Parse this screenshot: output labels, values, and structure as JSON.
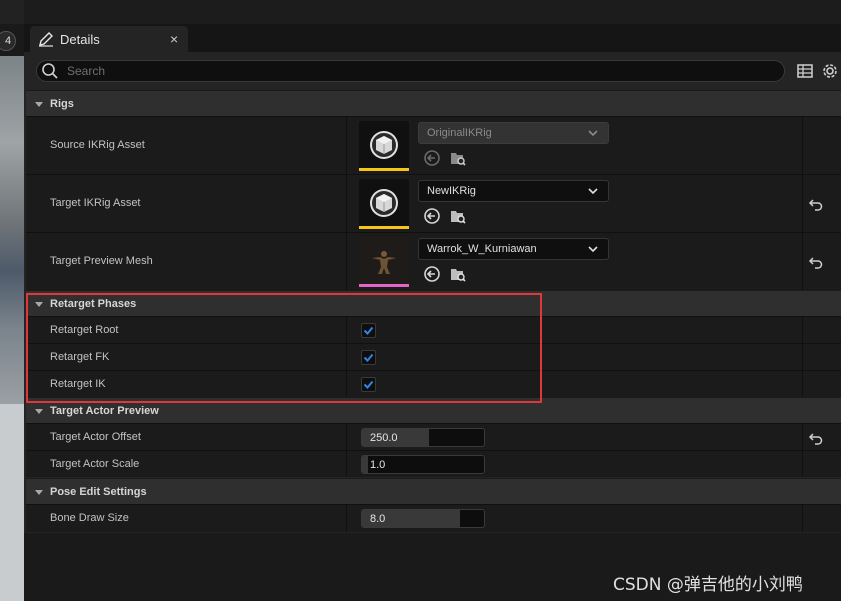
{
  "viewport": {
    "badge": "4"
  },
  "tab": {
    "label": "Details",
    "close": "×"
  },
  "search": {
    "placeholder": "Search"
  },
  "categories": {
    "rigs": "Rigs",
    "retarget_phases": "Retarget Phases",
    "target_actor_preview": "Target Actor Preview",
    "pose_edit_settings": "Pose Edit Settings"
  },
  "rigs": {
    "source_ikrig": {
      "label": "Source IKRig Asset",
      "value": "OriginalIKRig"
    },
    "target_ikrig": {
      "label": "Target IKRig Asset",
      "value": "NewIKRig"
    },
    "target_preview_mesh": {
      "label": "Target Preview Mesh",
      "value": "Warrok_W_Kurniawan"
    }
  },
  "retarget_phases": {
    "root": {
      "label": "Retarget Root",
      "checked": true
    },
    "fk": {
      "label": "Retarget FK",
      "checked": true
    },
    "ik": {
      "label": "Retarget IK",
      "checked": true
    }
  },
  "target_actor_preview": {
    "offset": {
      "label": "Target Actor Offset",
      "value": "250.0",
      "fill_fraction": 0.55
    },
    "scale": {
      "label": "Target Actor Scale",
      "value": "1.0",
      "fill_fraction": 0.05
    }
  },
  "pose_edit": {
    "bone_draw_size": {
      "label": "Bone Draw Size",
      "value": "8.0",
      "fill_fraction": 0.8
    }
  },
  "colors": {
    "accent_yellow": "#f5c518",
    "accent_pink": "#e066c8",
    "checkbox_blue": "#2f86e8",
    "highlight_red": "#e0383a"
  },
  "watermark": "CSDN @弹吉他的小刘鸭"
}
